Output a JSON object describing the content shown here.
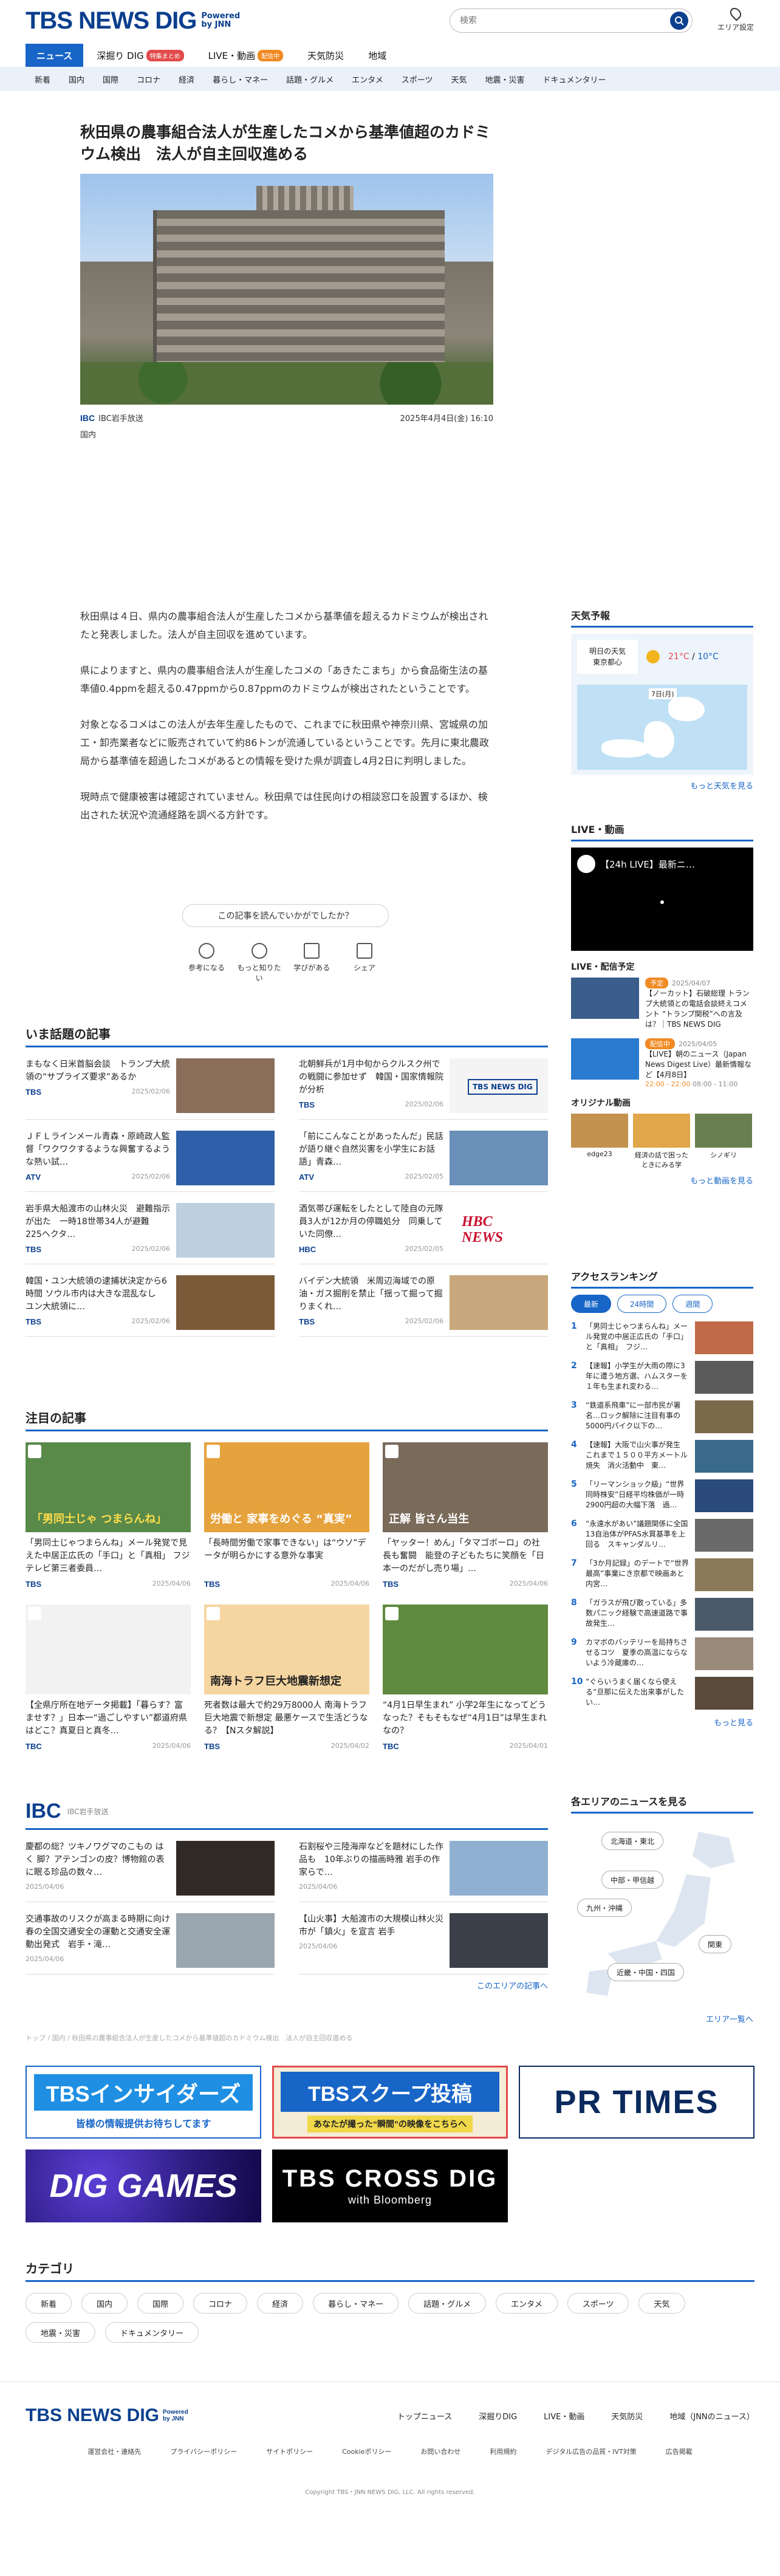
{
  "header": {
    "logo": "TBS NEWS DIG",
    "powered": "Powered by JNN",
    "search_placeholder": "検索",
    "area_label": "エリア設定"
  },
  "nav_main": [
    {
      "label": "ニュース",
      "active": true
    },
    {
      "label": "深掘り DIG",
      "badge": "特集まとめ"
    },
    {
      "label": "LIVE・動画",
      "badge": "配信中"
    },
    {
      "label": "天気防災"
    },
    {
      "label": "地域"
    }
  ],
  "nav_sub": [
    "新着",
    "国内",
    "国際",
    "コロナ",
    "経済",
    "暮らし・マネー",
    "話題・グルメ",
    "エンタメ",
    "スポーツ",
    "天気",
    "地震・災害",
    "ドキュメンタリー"
  ],
  "article": {
    "title": "秋田県の農事組合法人が生産したコメから基準値超のカドミウム検出　法人が自主回収進める",
    "source": "IBC岩手放送",
    "source_logo": "IBC",
    "date": "2025年4月4日(金) 16:10",
    "category": "国内",
    "paragraphs": [
      "秋田県は４日、県内の農事組合法人が生産したコメから基準値を超えるカドミウムが検出されたと発表しました。法人が自主回収を進めています。",
      "県によりますと、県内の農事組合法人が生産したコメの「あきたこまち」から食品衛生法の基準値0.4ppmを超える0.47ppmから0.87ppmのカドミウムが検出されたということです。",
      "対象となるコメはこの法人が去年生産したもので、これまでに秋田県や神奈川県、宮城県の加工・卸売業者などに販売されていて約86トンが流通しているということです。先月に東北農政局から基準値を超過したコメがあるとの情報を受けた県が調査し4月2日に判明しました。",
      "現時点で健康被害は確認されていません。秋田県では住民向けの相談窓口を設置するほか、検出された状況や流通経路を調べる方針です。"
    ]
  },
  "feedback": {
    "question": "この記事を読んでいかがでしたか？",
    "options": [
      "参考になる",
      "もっと知りたい",
      "学びがある",
      "シェア"
    ]
  },
  "weather": {
    "heading": "天気予報",
    "loc_line1": "明日の天気",
    "loc_line2": "東京都心",
    "hi": "21°C",
    "lo": "10°C",
    "sep": "/",
    "date_label": "7日(月)",
    "more": "もっと天気を見る"
  },
  "live": {
    "heading": "LIVE・動画",
    "video_title": "【24h LIVE】最新ニ…",
    "schedule_heading": "LIVE・配信予定",
    "items": [
      {
        "tag": "予定",
        "date": "2025/04/07",
        "text": "【ノーカット】石破総理 トランプ大統領との電話会談終えコメント “トランプ関税”への言及は？｜TBS NEWS DIG"
      },
      {
        "tag": "配信中",
        "date": "2025/04/05",
        "text": "【LIVE】朝のニュース（Japan News Digest Live）最新情報など【4月8日】",
        "time": "22:00 - 22:00",
        "meta": "08:00 - 11:00"
      }
    ],
    "originals_heading": "オリジナル動画",
    "originals": [
      "edge23",
      "経済の話で困ったときにみる学",
      "シノギリ"
    ],
    "more": "もっと動画を見る"
  },
  "ranking": {
    "heading": "アクセスランキング",
    "tabs": [
      "最新",
      "24時間",
      "週間"
    ],
    "items": [
      "「男同士じゃつまらんね」メール発覚の中居正広氏の「手口」と「真相」　フジ…",
      "【速報】小学生が大雨の際に3年に遭う地方選、ハムスターを１年も生まれ変わる…",
      "“鉄道系飛車”に一部市民が署名…ロック解除に注目有事の5000円パイク以下の…",
      "【速報】大阪で山火事が発生　これまで１５００平方メートル焼失　消火活動中　東…",
      "「リーマンショック級」“世界同時株安”日経平均株価が一時2900円超の大幅下落　過…",
      "“永遠水があい”議題関係に全国13自治体がPFAS水質基準を上回る　スキャンダルリ…",
      "「3か月記録」のデートで“世界最高”事業にき京都で映画あと内宮…",
      "「ガラスが飛び散っている」多数パニック経験で高速道路で事故発生…",
      "カマボのバッテリーを局持ちさせるコツ　夏季の高温にならないよう冷蔵庫の…",
      "“ぐらいうまく届くなら使える”旦那に伝えた出来事がしたい…"
    ],
    "more": "もっと見る"
  },
  "areas": {
    "heading": "各エリアのニュースを見る",
    "buttons": [
      "北海道・東北",
      "中部・甲信越",
      "九州・沖縄",
      "関東",
      "近畿・中国・四国"
    ],
    "more": "エリア一覧へ"
  },
  "trending": {
    "heading": "いま話題の記事",
    "items": [
      {
        "text": "まもなく日米首脳会談　トランプ大統領の“サプライズ要求”あるか",
        "brand": "TBS",
        "date": "2025/02/06"
      },
      {
        "text": "北朝鮮兵が1月中旬からクルスク州での戦闘に参加せず　韓国・国家情報院が分析",
        "brand": "TBS",
        "date": "2025/02/06"
      },
      {
        "text": "ＪＦＬラインメール青森・原崎政人監督「ワクワクするような興奮するような熱い試…",
        "brand": "ATV",
        "date": "2025/02/06"
      },
      {
        "text": "「前にこんなことがあったんだ」民話が語り継ぐ自然災害を小学生にお話語」青森…",
        "brand": "ATV",
        "date": "2025/02/05"
      },
      {
        "text": "岩手県大船渡市の山林火災　避難指示が出た　一時18世帯34人が避難　225ヘクタ…",
        "brand": "TBS",
        "date": "2025/02/06"
      },
      {
        "text": "酒気帯び運転をしたとして陸自の元隊員3人が12か月の停職処分　同乗していた同僚…",
        "brand": "HBC",
        "date": "2025/02/05"
      },
      {
        "text": "韓国・ユン大統領の逮捕状決定から6時間 ソウル市内は大きな混乱なし　ユン大統領に…",
        "brand": "TBS",
        "date": "2025/02/06"
      },
      {
        "text": "バイデン大統領　米周辺海域での原油・ガス掘削を禁止「揺って掘って掘りまくれ…",
        "brand": "TBS",
        "date": "2025/02/06"
      }
    ],
    "thumb_brand": "TBS NEWS DIG",
    "hbc_logo": "HBC NEWS"
  },
  "featured": {
    "heading": "注目の記事",
    "items": [
      {
        "text": "「男同士じゃつまらんね」メール発覚で見えた中居正広氏の「手口」と「真相」 フジテレビ第三者委員…",
        "brand": "TBS",
        "date": "2025/04/06",
        "cap": "「男同士じゃ つまらんね」"
      },
      {
        "text": "「長時間労働で家事できない」は“ウソ”データが明らかにする意外な事実",
        "brand": "TBS",
        "date": "2025/04/06",
        "cap": "労働と 家事をめぐる “真実”"
      },
      {
        "text": "「ヤッター！めん」「タマゴボーロ」の社長も奮闘　能登の子どもたちに笑顔を「日本一のだがし売り場」…",
        "brand": "TBS",
        "date": "2025/04/06",
        "cap": "正解 皆さん当生"
      },
      {
        "text": "【全県庁所在地データ掲載】「暮らす？富ませす？」日本一“過ごしやすい”都道府県はどこ？真夏日と真冬…",
        "brand": "TBC",
        "date": "2025/04/06",
        "cap": ""
      },
      {
        "text": "死者数は最大で約29万8000人 南海トラフ巨大地震で新想定 最悪ケースで生活どうなる？【Nスタ解説】",
        "brand": "TBS",
        "date": "2025/04/02",
        "cap": "南海トラフ巨大地震新想定"
      },
      {
        "text": "“4月1日早生まれ” 小学2年生になってどうなった？そもそもなぜ“4月1日”は早生まれなの？",
        "brand": "TBC",
        "date": "2025/04/01",
        "cap": ""
      }
    ]
  },
  "bank": {
    "logo": "IBC",
    "name": "IBC岩手放送",
    "items": [
      {
        "text": "慶都の総？ツキノワグマのこもの は く 脚？アテンゴンの皮？博物館の表に眠る珍品の数々…",
        "date": "2025/04/06"
      },
      {
        "text": "石割桜や三陸海岸などを題材にした作品も　10年ぶりの描画時雅 岩手の作家らで…",
        "date": "2025/04/06"
      },
      {
        "text": "交通事故のリスクが高まる時期に向け　春の全国交通安全の運動と交通安全運動出発式　岩手・滝…",
        "date": "2025/04/06"
      },
      {
        "text": "【山火事】大船渡市の大規模山林火災　市が「鎮火」を宣言 岩手",
        "date": "2025/04/06"
      }
    ],
    "more": "このエリアの記事へ"
  },
  "breadcrumb": "トップ / 国内 / 秋田県の農事組合法人が生産したコメから基準値超のカドミウム検出　法人が自主回収進める",
  "banners": [
    {
      "title": "TBSインサイダーズ",
      "sub": "皆様の情報提供お待ちしてます"
    },
    {
      "title": "TBSスクープ投稿",
      "sub": "あなたが撮った“瞬間”の映像をこちらへ"
    },
    {
      "title": "PR TIMES"
    },
    {
      "title": "DIG GAMES"
    },
    {
      "title": "TBS CROSS DIG",
      "sub": "with Bloomberg"
    }
  ],
  "categories": {
    "heading": "カテゴリ",
    "items": [
      "新着",
      "国内",
      "国際",
      "コロナ",
      "経済",
      "暮らし・マネー",
      "話題・グルメ",
      "エンタメ",
      "スポーツ",
      "天気",
      "地震・災害",
      "ドキュメンタリー"
    ]
  },
  "footer": {
    "logo": "TBS NEWS DIG",
    "powered": "Powered by JNN",
    "nav": [
      "トップニュース",
      "深掘りDIG",
      "LIVE・動画",
      "天気防災",
      "地域（JNNのニュース）"
    ],
    "links": [
      "運営会社・連絡先",
      "プライバシーポリシー",
      "サイトポリシー",
      "Cookieポリシー",
      "お問い合わせ",
      "利用規約",
      "デジタル広告の品質・IVT対策",
      "広告掲載"
    ],
    "copyright": "Copyright TBS・JNN NEWS DIG, LLC. All rights reserved."
  },
  "colors": {
    "brand": "#0b3f8e",
    "accent": "#1765c7",
    "live": "#f08a24",
    "alert": "#e24b4b"
  }
}
